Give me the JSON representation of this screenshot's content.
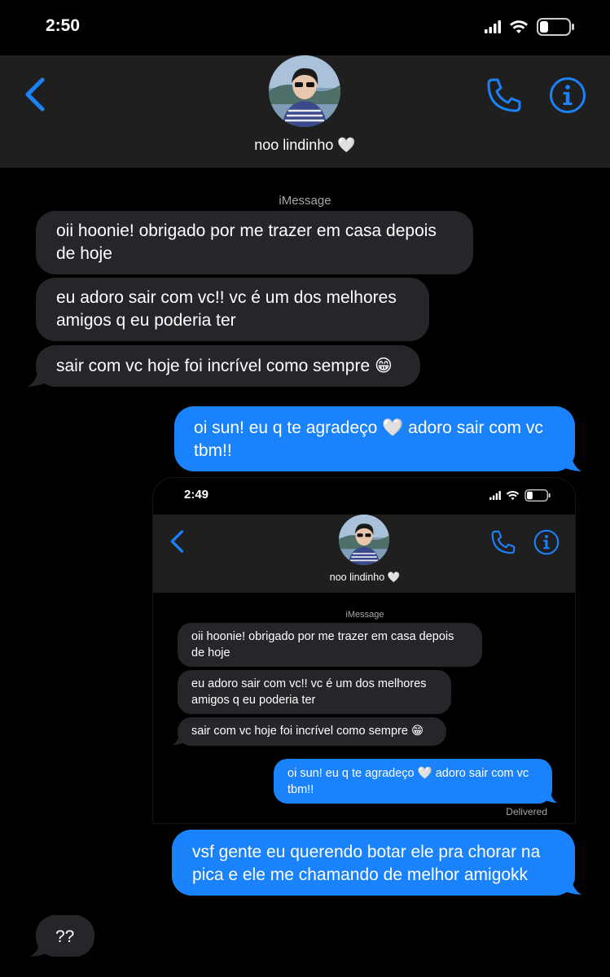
{
  "status_bar": {
    "time": "2:50"
  },
  "header": {
    "contact_name": "noo lindinho 🤍"
  },
  "thread": {
    "service_label": "iMessage",
    "messages": [
      {
        "direction": "incoming",
        "text_lines": [
          "oii hoonie! obrigado por me trazer em casa depois",
          "de hoje"
        ]
      },
      {
        "direction": "incoming",
        "text_lines": [
          "eu adoro sair com vc!! vc é um dos melhores",
          "amigos q eu poderia ter"
        ]
      },
      {
        "direction": "incoming",
        "text_lines": [
          "sair com vc hoje foi incrível como sempre 😁"
        ]
      },
      {
        "direction": "outgoing",
        "text_lines": [
          "oi sun! eu q te agradeço 🤍 adoro sair com vc",
          "tbm!!"
        ]
      },
      {
        "direction": "outgoing",
        "text_lines": [
          "vsf gente eu querendo botar ele pra chorar na",
          "pica e ele me chamando de melhor amigokk"
        ]
      },
      {
        "direction": "incoming",
        "text_lines": [
          "??"
        ]
      }
    ]
  },
  "embedded_screenshot": {
    "status_time": "2:49",
    "contact_name": "noo lindinho 🤍",
    "service_label": "iMessage",
    "messages": [
      {
        "direction": "incoming",
        "text_lines": [
          "oii hoonie! obrigado por me trazer em casa depois",
          "de hoje"
        ]
      },
      {
        "direction": "incoming",
        "text_lines": [
          "eu adoro sair com vc!! vc é um dos melhores",
          "amigos q eu poderia ter"
        ]
      },
      {
        "direction": "incoming",
        "text_lines": [
          "sair com vc hoje foi incrível como sempre 😁"
        ]
      },
      {
        "direction": "outgoing",
        "text_lines": [
          "oi sun! eu q te agradeço 🤍 adoro sair com vc",
          "tbm!!"
        ]
      }
    ],
    "delivery_status": "Delivered"
  },
  "colors": {
    "background": "#000000",
    "header_bg": "#1f1f1f",
    "incoming_bubble": "#26252a",
    "outgoing_bubble": "#1a82fb",
    "accent_icon": "#1a82fb",
    "muted_text": "#a7a7ab"
  },
  "icons": [
    "back-chevron-icon",
    "phone-icon",
    "info-icon",
    "signal-icon",
    "wifi-icon",
    "battery-icon"
  ]
}
